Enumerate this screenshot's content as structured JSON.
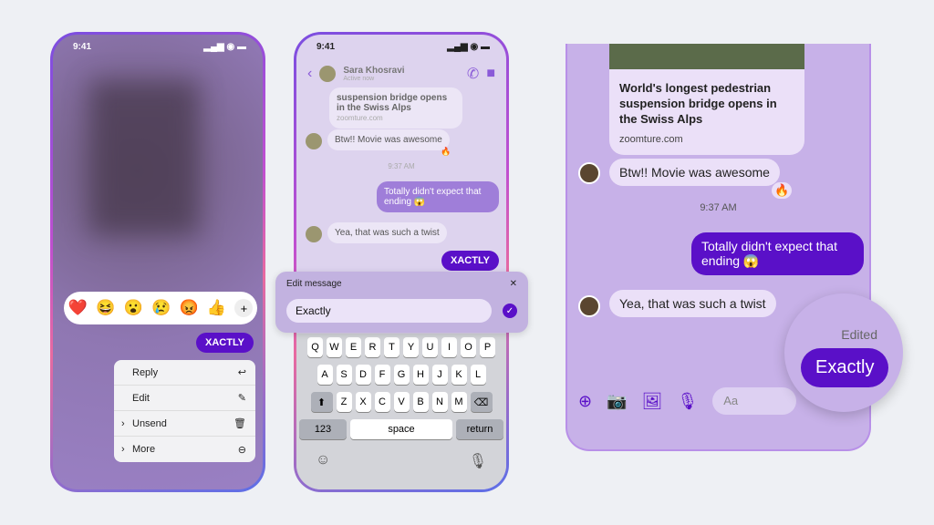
{
  "phone1": {
    "time": "9:41",
    "reactions": [
      "❤️",
      "😆",
      "😮",
      "😢",
      "😡",
      "👍"
    ],
    "reaction_more": "+",
    "bubble": "XACTLY",
    "menu": [
      {
        "label": "Reply",
        "icon": "↩"
      },
      {
        "label": "Edit",
        "icon": "✎"
      },
      {
        "label": "Unsend",
        "icon": "🗑"
      },
      {
        "label": "More",
        "icon": "⊖"
      }
    ]
  },
  "phone2": {
    "time": "9:41",
    "contact": "Sara Khosravi",
    "presence": "Active now",
    "link_preview": "suspension bridge opens in the Swiss Alps",
    "link_domain": "zoomture.com",
    "msg1": "Btw!! Movie was awesome",
    "reaction1": "🔥",
    "timestamp": "9:37 AM",
    "msg2": "Totally didn't expect that ending 😱",
    "msg3": "Yea, that was such a twist",
    "msg4": "XACTLY",
    "edit_title": "Edit message",
    "edit_value": "Exactly",
    "keys_row1": [
      "Q",
      "W",
      "E",
      "R",
      "T",
      "Y",
      "U",
      "I",
      "O",
      "P"
    ],
    "keys_row2": [
      "A",
      "S",
      "D",
      "F",
      "G",
      "H",
      "J",
      "K",
      "L"
    ],
    "keys_row3": [
      "Z",
      "X",
      "C",
      "V",
      "B",
      "N",
      "M"
    ],
    "key_123": "123",
    "key_space": "space",
    "key_return": "return"
  },
  "phone3": {
    "link_title": "World's longest pedestrian suspension bridge opens in the Swiss Alps",
    "link_domain": "zoomture.com",
    "msg1": "Btw!! Movie was awesome",
    "reaction1": "🔥",
    "timestamp": "9:37 AM",
    "msg2": "Totally didn't expect that ending 😱",
    "msg3": "Yea, that was such a twist",
    "edited_label": "Edited",
    "edited_msg": "Exactly",
    "input_placeholder": "Aa"
  },
  "colors": {
    "accent": "#5a10c8",
    "bg": "#eef0f4",
    "chat_bg": "#c7b1e8"
  }
}
